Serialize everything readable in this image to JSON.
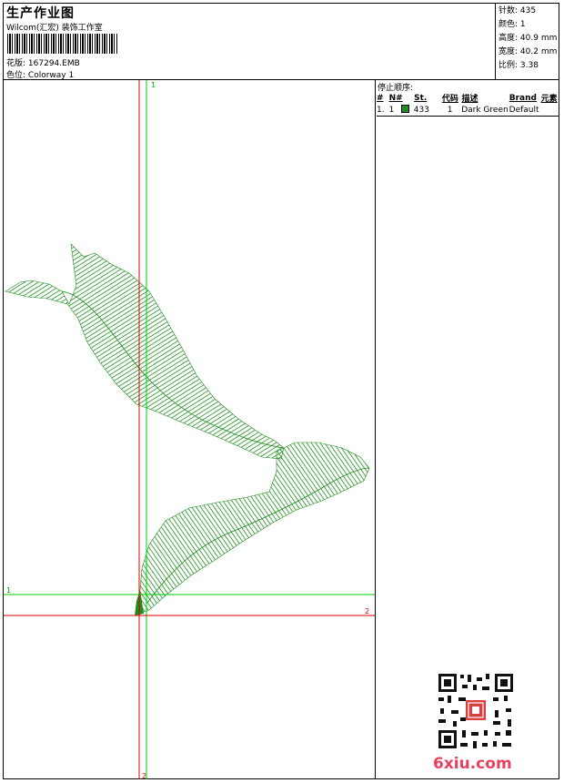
{
  "header": {
    "title": "生产作业图",
    "company": "Wilcom(汇宏) 装饰工作室",
    "design_label": "花版:",
    "design_value": "167294.EMB",
    "colorway_label": "色位:",
    "colorway_value": "Colorway 1"
  },
  "stats": {
    "stitches_label": "针数:",
    "stitches_value": "435",
    "colors_label": "颜色:",
    "colors_value": "1",
    "height_label": "高度:",
    "height_value": "40.9 mm",
    "width_label": "宽度:",
    "width_value": "40.2 mm",
    "scale_label": "比例:",
    "scale_value": "3.38"
  },
  "stop_sequence": {
    "title": "停止顺序:",
    "columns": [
      "#",
      "N#",
      "",
      "St.",
      "代码",
      "描述",
      "Brand",
      "元素"
    ],
    "rows": [
      {
        "idx": "1.",
        "n": "1",
        "color": "#1e8c1e",
        "stitches": "433",
        "code": "1",
        "desc": "Dark Green",
        "brand": "Default",
        "element": ""
      }
    ]
  },
  "canvas": {
    "markers": {
      "v_green_top": "1",
      "h_green_left": "1",
      "h_red_right": "2",
      "v_red_bottom": "2"
    },
    "colors": {
      "thread": "#1e8c1e",
      "guide_green": "#00cc00",
      "guide_red": "#dd0000"
    }
  },
  "watermark": {
    "text": "6xiu.com",
    "color": "#e84060"
  }
}
